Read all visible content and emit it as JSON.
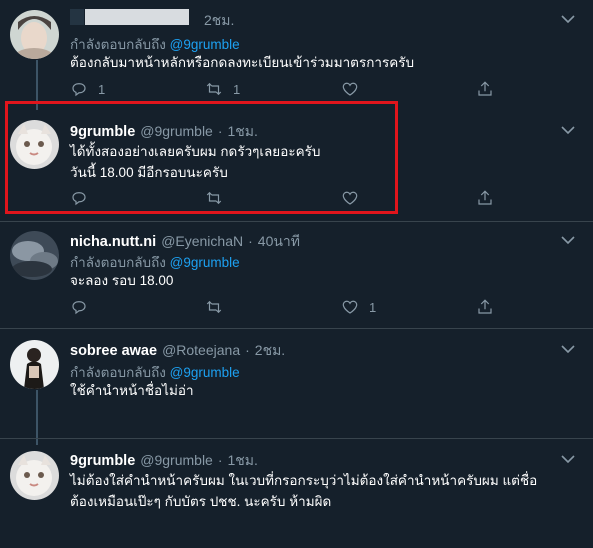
{
  "colors": {
    "background": "#15202b",
    "divider": "#38444d",
    "muted": "#8899a6",
    "link": "#1da1f2",
    "highlight_border": "#e0151c"
  },
  "tweets": [
    {
      "name": "",
      "handle": "",
      "time": "2ชม.",
      "replying_prefix": "กำลังตอบกลับถึง",
      "replying_to": "@9grumble",
      "lines": [
        "ต้องกลับมาหน้าหลักหรือกดลงทะเบียนเข้าร่วมมาตรการครับ"
      ],
      "reply_count": "1",
      "retweet_count": "1",
      "like_count": ""
    },
    {
      "name": "9grumble",
      "handle": "@9grumble",
      "time": "1ชม.",
      "lines": [
        "ได้ทั้งสองอย่างเลยครับผม กดรัวๆเลยอะครับ",
        "วันนี้ 18.00 มีอีกรอบนะครับ"
      ],
      "reply_count": "",
      "retweet_count": "",
      "like_count": ""
    },
    {
      "name": "nicha.nutt.ni",
      "handle": "@EyenichaN",
      "time": "40นาที",
      "replying_prefix": "กำลังตอบกลับถึง",
      "replying_to": "@9grumble",
      "lines": [
        "จะลอง รอบ 18.00"
      ],
      "reply_count": "",
      "retweet_count": "",
      "like_count": "1"
    },
    {
      "name": "sobree awae",
      "handle": "@Roteejana",
      "time": "2ชม.",
      "replying_prefix": "กำลังตอบกลับถึง",
      "replying_to": "@9grumble",
      "lines": [
        "ใช้คำนำหน้าชื่อไม่อ่า"
      ]
    },
    {
      "name": "9grumble",
      "handle": "@9grumble",
      "time": "1ชม.",
      "lines": [
        "ไม่ต้องใส่คำนำหน้าครับผม ในเวบที่กรอกระบุว่าไม่ต้องใส่คำนำหน้าครับผม แต่ชื่อ",
        "ต้องเหมือนเป๊ะๆ กับบัตร ปชช. นะครับ ห้ามผิด"
      ]
    }
  ],
  "separator": "·",
  "icons": [
    "chevron-down-icon",
    "reply-icon",
    "retweet-icon",
    "like-icon",
    "share-icon"
  ]
}
